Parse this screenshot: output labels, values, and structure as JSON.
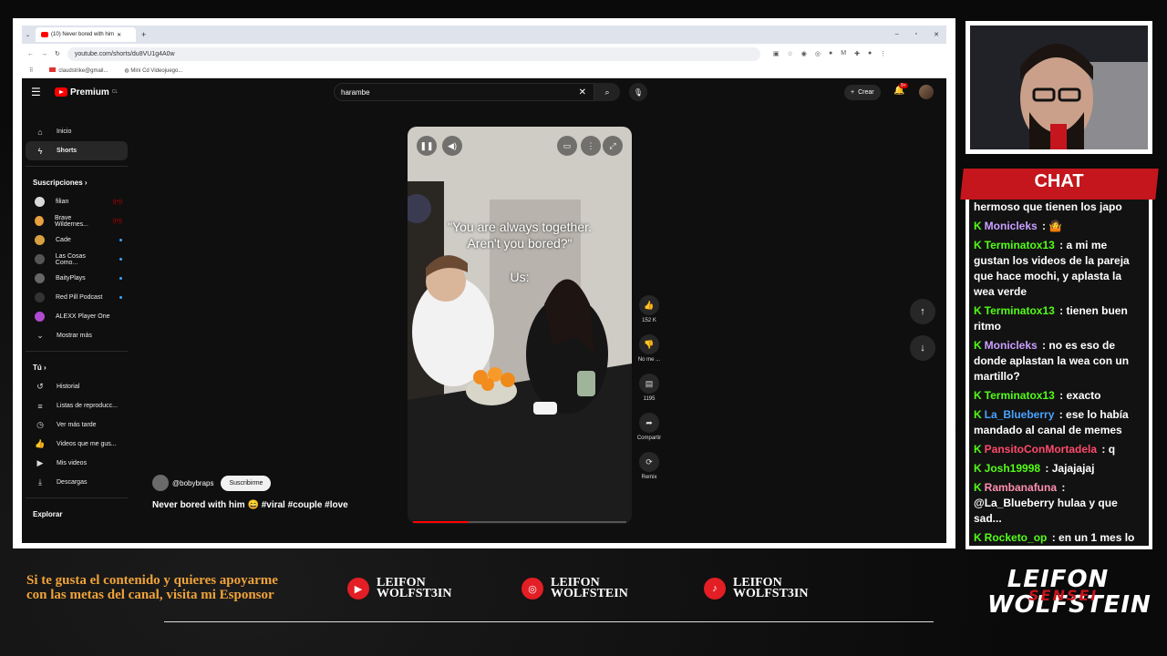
{
  "browser": {
    "tab_title": "(10) Never bored with him",
    "url": "youtube.com/shorts/du8VU1g4A0w",
    "bookmarks": [
      "claudstrike@gmail...",
      "Mini Cd Videojuego..."
    ]
  },
  "youtube": {
    "logo_label": "Premium",
    "logo_country": "CL",
    "search_value": "harambe",
    "create_label": "Crear",
    "notif_badge": "9+",
    "sidebar": {
      "main": [
        {
          "label": "Inicio",
          "icon": "home-icon"
        },
        {
          "label": "Shorts",
          "icon": "shorts-icon"
        }
      ],
      "subscriptions_title": "Suscripciones",
      "subscriptions": [
        {
          "label": "filian",
          "status": "live",
          "color": "#d9d9d9"
        },
        {
          "label": "Brave Wildernes...",
          "status": "live",
          "color": "#e8a040"
        },
        {
          "label": "Cade",
          "status": "new",
          "color": "#d8a040"
        },
        {
          "label": "Las Cosas Como...",
          "status": "new",
          "color": "#555555"
        },
        {
          "label": "BaityPlays",
          "status": "new",
          "color": "#666666"
        },
        {
          "label": "Red Pill Podcast",
          "status": "new",
          "color": "#333333"
        },
        {
          "label": "ALEXX Player One",
          "status": "",
          "color": "#b04ad0"
        }
      ],
      "show_more": "Mostrar más",
      "you_title": "Tú",
      "you_items": [
        {
          "label": "Historial",
          "icon": "history-icon"
        },
        {
          "label": "Listas de reproducc...",
          "icon": "playlist-icon"
        },
        {
          "label": "Ver más tarde",
          "icon": "clock-icon"
        },
        {
          "label": "Videos que me gus...",
          "icon": "like-icon"
        },
        {
          "label": "Mis videos",
          "icon": "video-icon"
        },
        {
          "label": "Descargas",
          "icon": "download-icon"
        }
      ],
      "explore_title": "Explorar"
    },
    "short": {
      "caption_line1": "\"You are always together.",
      "caption_line2": "Aren't you bored?\"",
      "caption_us": "Us:",
      "progress": 0.26,
      "channel": "@bobybraps",
      "subscribe": "Suscribirme",
      "title": "Never bored with him 😄 #viral #couple #love",
      "actions": [
        {
          "label": "152 K",
          "icon": "thumbs-up-icon"
        },
        {
          "label": "No me ...",
          "icon": "thumbs-down-icon"
        },
        {
          "label": "1195",
          "icon": "comment-icon"
        },
        {
          "label": "Compartir",
          "icon": "share-icon"
        },
        {
          "label": "Remix",
          "icon": "remix-icon"
        }
      ]
    }
  },
  "chat": {
    "title": "CHAT",
    "messages": [
      {
        "user": "",
        "text": "hermoso que tienen los japo",
        "color": "#ffffff"
      },
      {
        "user": "Monicleks",
        "text": " : 🤷",
        "color": "#c9a0ff"
      },
      {
        "user": "Terminatox13",
        "text": " : a mi me gustan los videos de la pareja que hace mochi, y aplasta la wea verde",
        "color": "#53fc18"
      },
      {
        "user": "Terminatox13",
        "text": " : tienen buen ritmo",
        "color": "#53fc18"
      },
      {
        "user": "Monicleks",
        "text": " : no es eso de donde aplastan la wea con un martillo?",
        "color": "#c9a0ff"
      },
      {
        "user": "Terminatox13",
        "text": " : exacto",
        "color": "#53fc18"
      },
      {
        "user": "La_Blueberry",
        "text": " : ese lo había mandado al canal de memes",
        "color": "#4aa3ff"
      },
      {
        "user": "PansitoConMortadela",
        "text": " : q",
        "color": "#ff4a6a"
      },
      {
        "user": "Josh19998",
        "text": " : Jajajajaj",
        "color": "#53fc18"
      },
      {
        "user": "Rambanafuna",
        "text": " : @La_Blueberry hulaa y que sad...",
        "color": "#ff8fb0"
      },
      {
        "user": "Rocketo_op",
        "text": " : en un 1 mes lo volvera a ver",
        "color": "#53fc18"
      }
    ]
  },
  "footer": {
    "sponsor_text": "Si te gusta el contenido y quieres apoyarme con las metas del canal, visita mi Esponsor",
    "socials": [
      {
        "line1": "LEIFON",
        "line2": "WOLFST3IN",
        "icon": "youtube-icon"
      },
      {
        "line1": "LEIFON",
        "line2": "WOLFSTEIN",
        "icon": "instagram-icon"
      },
      {
        "line1": "LEIFON",
        "line2": "WOLFST3IN",
        "icon": "tiktok-icon"
      }
    ],
    "brand_line1": "LEIFON",
    "brand_line2": "WOLFSTEIN",
    "brand_overlay": "SENSEI"
  }
}
